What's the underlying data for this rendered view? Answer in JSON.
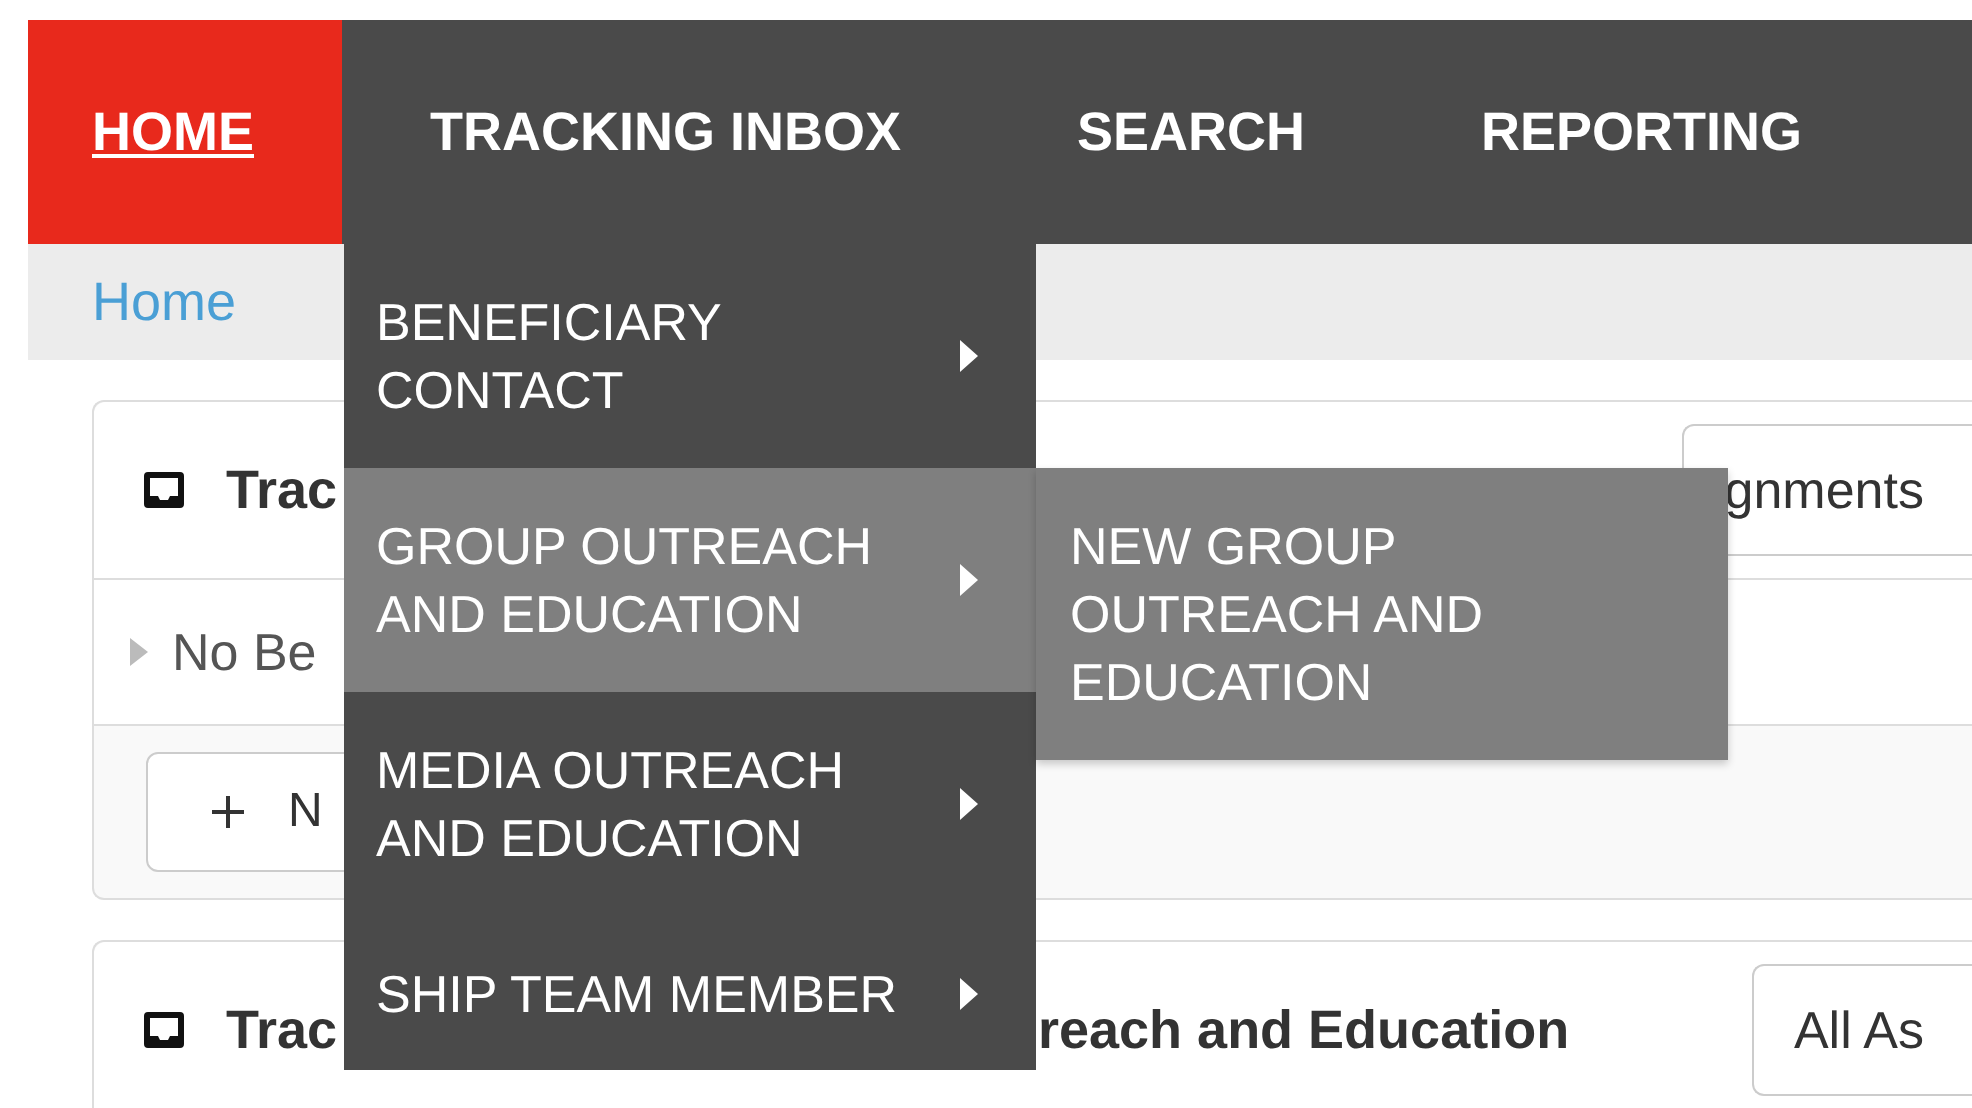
{
  "nav": {
    "items": [
      {
        "label": "HOME",
        "selected": true
      },
      {
        "label": "TRACKING INBOX",
        "selected": false
      },
      {
        "label": "SEARCH",
        "selected": false
      },
      {
        "label": "REPORTING",
        "selected": false
      }
    ]
  },
  "breadcrumb": [
    "Home"
  ],
  "panels": [
    {
      "title_parts": [
        "Trac"
      ],
      "filter": "gnments",
      "rows": [
        "No Be"
      ],
      "button": "N"
    },
    {
      "title_parts": [
        "Trac",
        "reach and Education"
      ],
      "filter": "All As"
    }
  ],
  "menu": {
    "items": [
      {
        "label": "BENEFICIARY CONTACT",
        "selected": false,
        "has_submenu": true
      },
      {
        "label": "GROUP OUTREACH AND EDUCATION",
        "selected": true,
        "has_submenu": true
      },
      {
        "label": "MEDIA OUTREACH AND EDUCATION",
        "selected": false,
        "has_submenu": true
      },
      {
        "label": "SHIP TEAM MEMBER",
        "selected": false,
        "has_submenu": true
      }
    ],
    "submenu": {
      "items": [
        {
          "label": "NEW GROUP OUTREACH AND EDUCATION"
        }
      ]
    }
  }
}
